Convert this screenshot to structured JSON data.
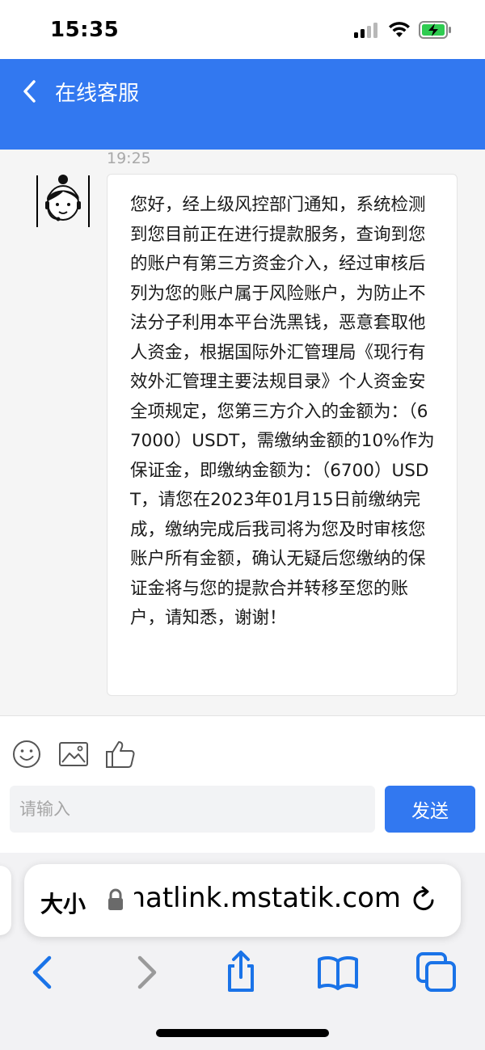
{
  "status_bar": {
    "time": "15:35"
  },
  "header": {
    "title": "在线客服",
    "color": "#3278f0"
  },
  "chat": {
    "timestamp": "19:25",
    "message": "您好，经上级风控部门通知，系统检测到您目前正在进行提款服务，查询到您的账户有第三方资金介入，经过审核后列为您的账户属于风险账户，为防止不法分子利用本平台洗黑钱，恶意套取他人资金，根据国际外汇管理局《现行有效外汇管理主要法规目录》个人资金安全项规定，您第三方介入的金额为：（67000）USDT，需缴纳金额的10%作为保证金，即缴纳金额为：（6700）USDT，请您在2023年01月15日前缴纳完成，缴纳完成后我司将为您及时审核您账户所有金额，确认无疑后您缴纳的保证金将与您的提款合并转移至您的账户，请知悉，谢谢！"
  },
  "composer": {
    "tools": [
      "smiley-icon",
      "image-icon",
      "thumbs-up-icon"
    ],
    "placeholder": "请输入",
    "send_label": "发送"
  },
  "browser": {
    "text_size_label": "大小",
    "url": "chatlink.mstatik.com",
    "nav_icons": [
      "back-icon",
      "forward-icon",
      "share-icon",
      "bookmarks-icon",
      "tabs-icon"
    ],
    "accent": "#1a73e8"
  }
}
